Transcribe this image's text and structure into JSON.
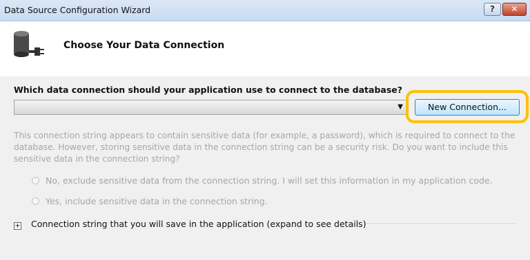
{
  "window": {
    "title": "Data Source Configuration Wizard",
    "help_glyph": "?",
    "close_glyph": "✕"
  },
  "header": {
    "title": "Choose Your Data Connection",
    "icon": "database-plug-icon"
  },
  "main": {
    "question": "Which data connection should your application use to connect to the database?",
    "connection_select": {
      "value": "",
      "arrow": "▼"
    },
    "new_connection_label": "New Connection...",
    "info_text": "This connection string appears to contain sensitive data (for example, a password), which is required to connect to the database. However, storing sensitive data in the connection string can be a security risk. Do you want to include this sensitive data in the connection string?",
    "radio_exclude": "No, exclude sensitive data from the connection string. I will set this information in my application code.",
    "radio_include": "Yes, include sensitive data in the connection string.",
    "expander_glyph": "+",
    "expander_label": "Connection string that you will save in the application (expand to see details)"
  },
  "colors": {
    "highlight": "#ffc000",
    "disabled_text": "#a6a6a6",
    "button_border": "#3c7fb1"
  }
}
